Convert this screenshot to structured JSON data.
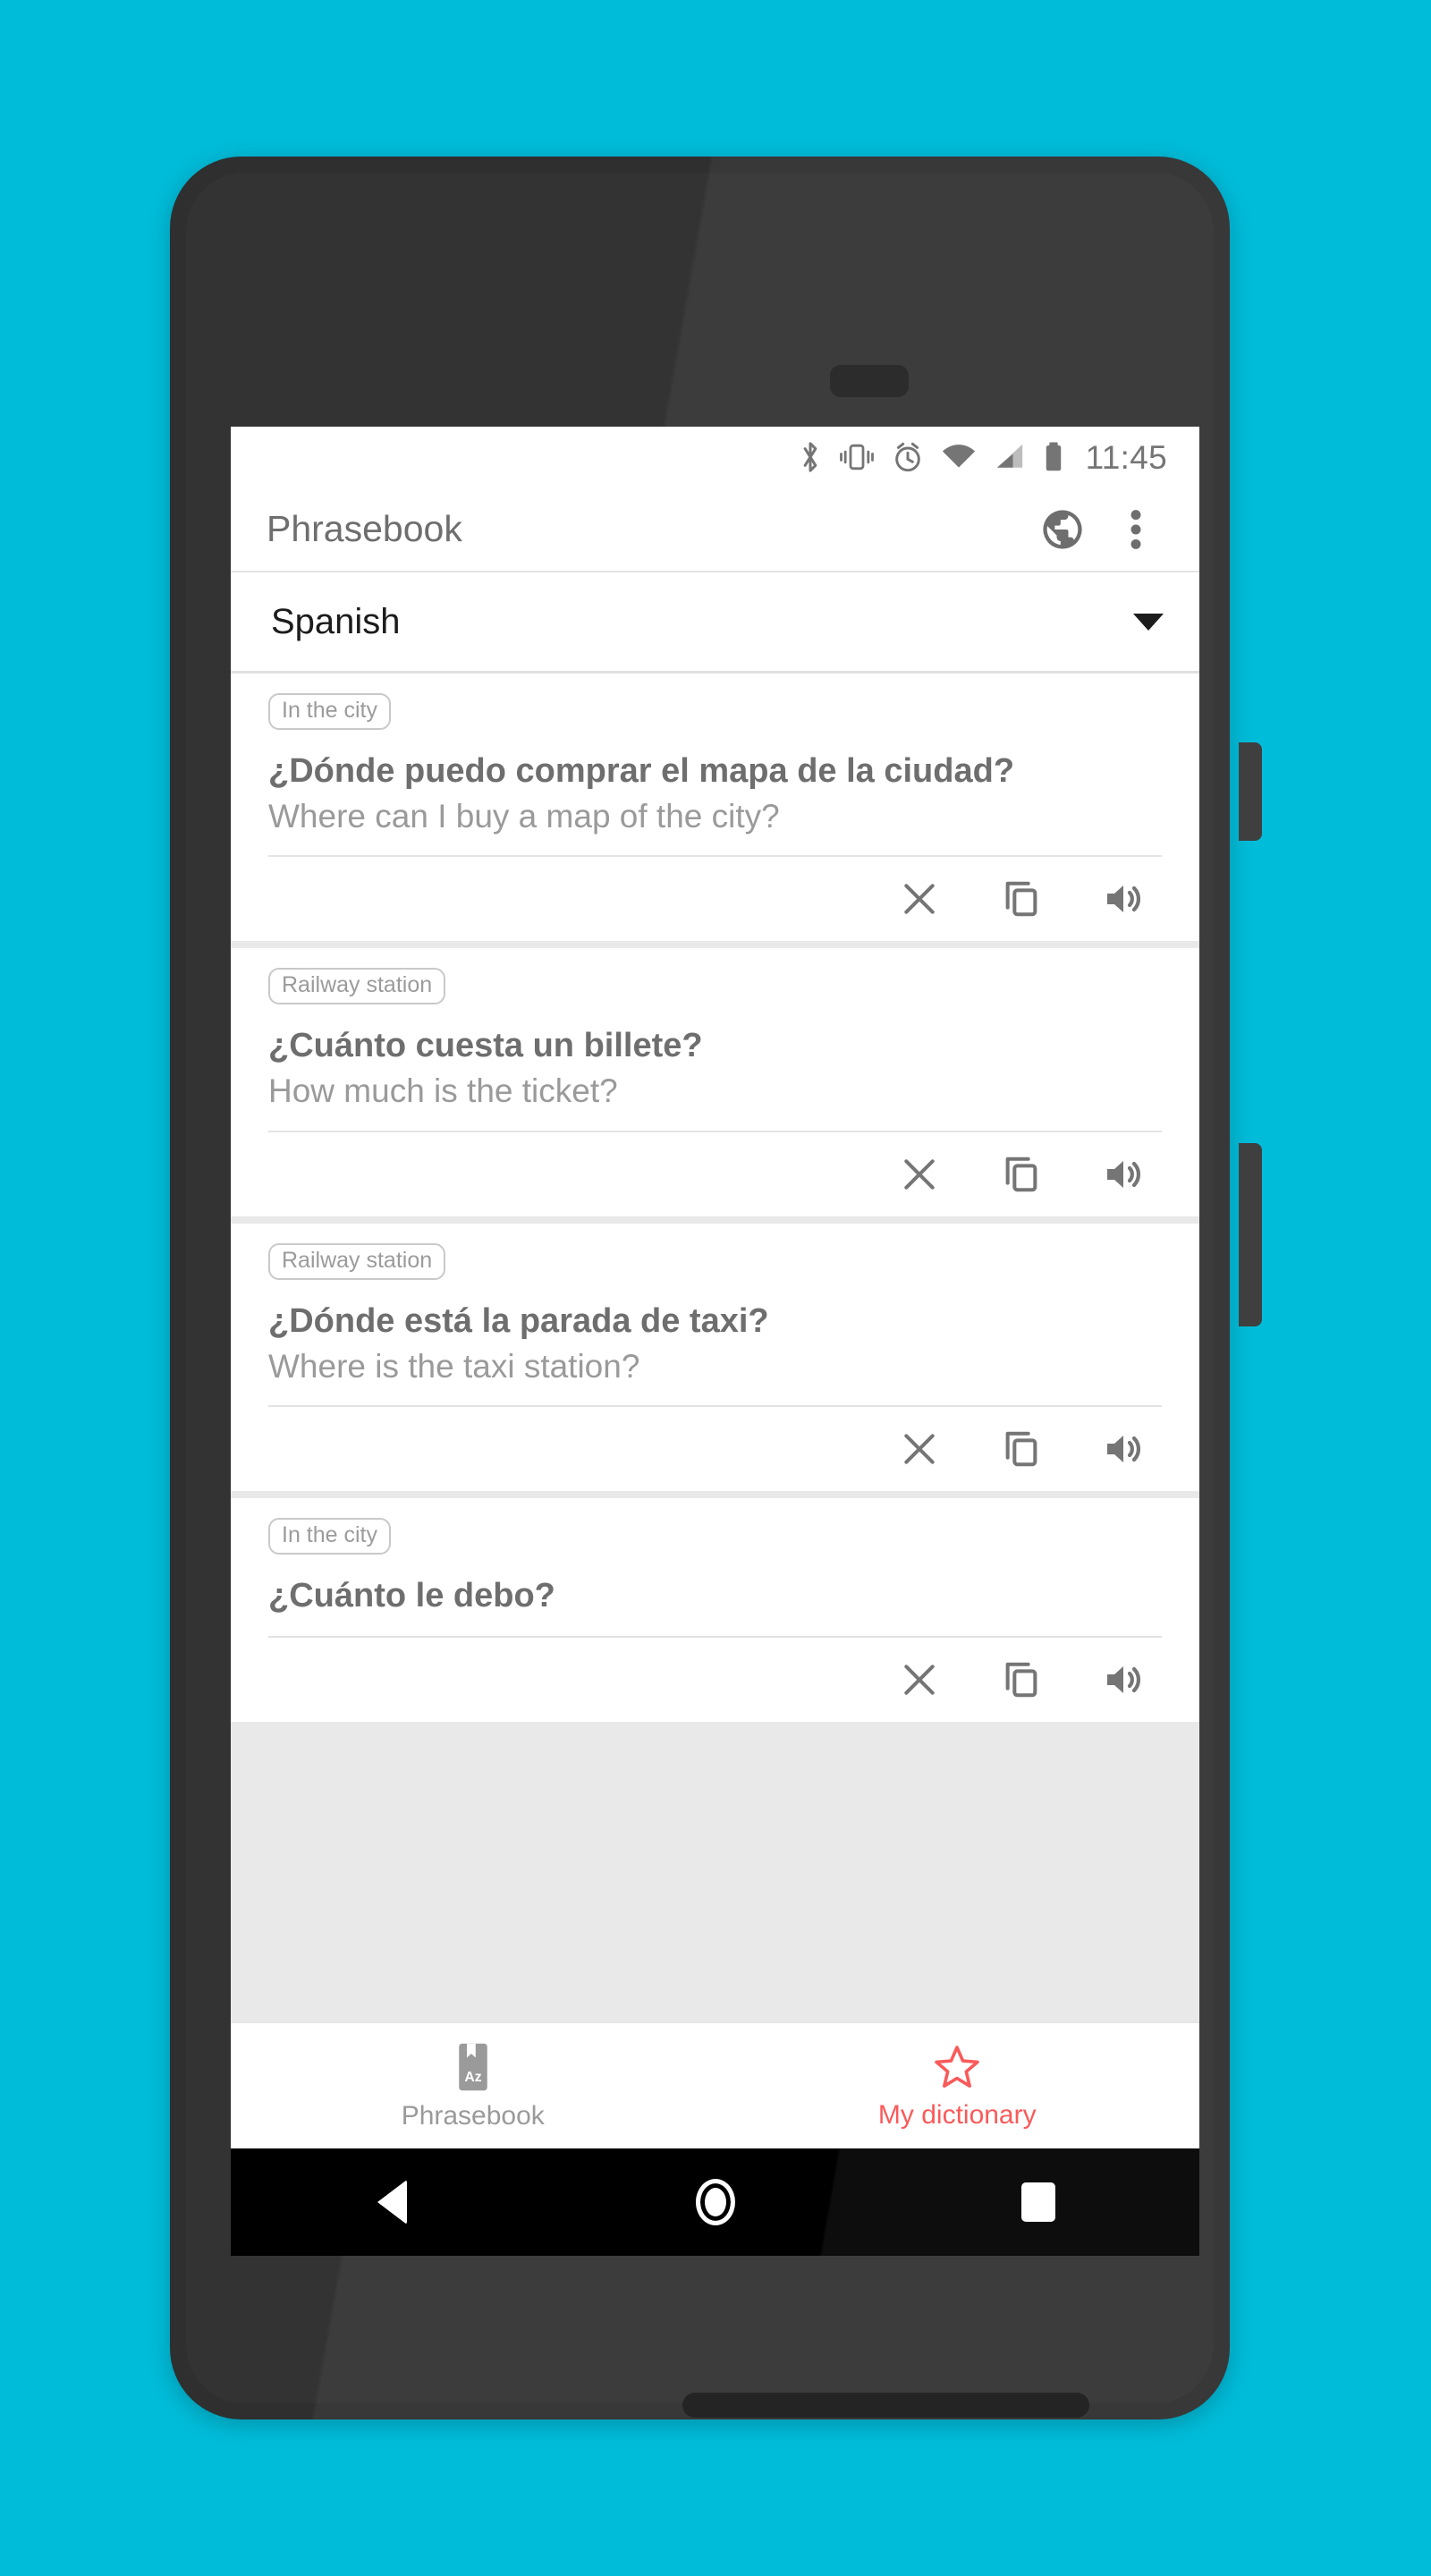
{
  "theme": {
    "background": "#00bcd9",
    "phone_body": "#2f2f2f",
    "accent": "#fa5a5a",
    "muted_text": "#9a9a9a",
    "title_text": "#6e6e6e"
  },
  "status_bar": {
    "time": "11:45",
    "icons": [
      "bluetooth-icon",
      "vibrate-icon",
      "alarm-icon",
      "wifi-icon",
      "cell-signal-icon",
      "battery-icon"
    ]
  },
  "app_bar": {
    "title": "Phrasebook",
    "actions": [
      {
        "name": "globe-icon",
        "label": "Globe"
      },
      {
        "name": "overflow-menu-icon",
        "label": "More options"
      }
    ]
  },
  "language_selector": {
    "value": "Spanish",
    "caret": "chevron-down-icon"
  },
  "card_actions": [
    {
      "name": "close-icon",
      "label": "Remove"
    },
    {
      "name": "copy-icon",
      "label": "Copy"
    },
    {
      "name": "speaker-icon",
      "label": "Speak"
    }
  ],
  "phrases": [
    {
      "category": "In the city",
      "source": "¿Dónde puedo comprar el mapa de la ciudad?",
      "target": "Where can I buy a map of the city?"
    },
    {
      "category": "Railway station",
      "source": "¿Cuánto cuesta un billete?",
      "target": "How much is the ticket?"
    },
    {
      "category": "Railway station",
      "source": "¿Dónde está la parada de taxi?",
      "target": "Where is the taxi station?"
    },
    {
      "category": "In the city",
      "source": "¿Cuánto le debo?",
      "target": ""
    }
  ],
  "bottom_nav": {
    "tabs": [
      {
        "label": "Phrasebook",
        "icon": "phrasebook-book-icon",
        "active": false
      },
      {
        "label": "My dictionary",
        "icon": "star-outline-icon",
        "active": true
      }
    ]
  },
  "android_nav": {
    "keys": [
      {
        "name": "back-button",
        "icon": "triangle-back-icon"
      },
      {
        "name": "home-button",
        "icon": "circle-home-icon"
      },
      {
        "name": "recents-button",
        "icon": "square-recents-icon"
      }
    ]
  }
}
